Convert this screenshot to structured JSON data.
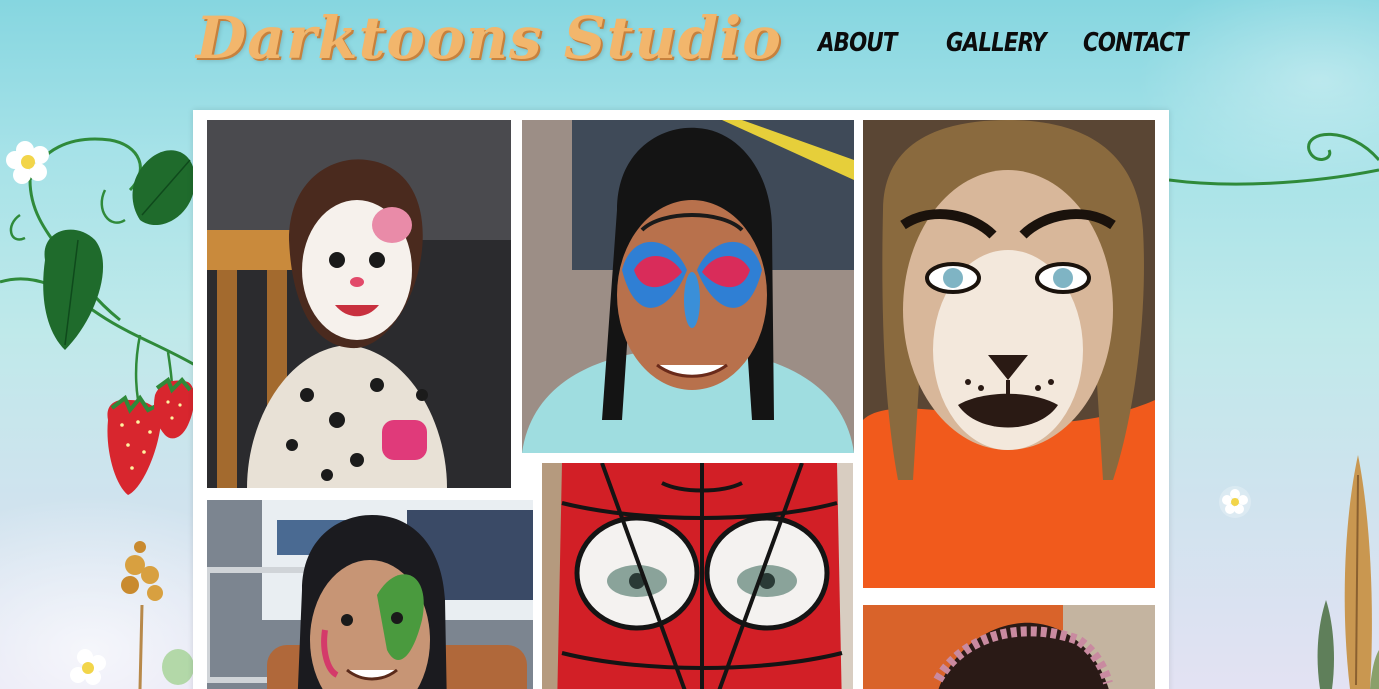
{
  "site": {
    "logo_text": "Darktoons  Studio"
  },
  "nav": {
    "items": [
      {
        "label": "ABOUT"
      },
      {
        "label": "GALLERY"
      },
      {
        "label": "CONTACT"
      }
    ]
  },
  "gallery": {
    "photos": [
      {
        "subject": "kitty face paint"
      },
      {
        "subject": "butterfly face paint"
      },
      {
        "subject": "lion face paint"
      },
      {
        "subject": "dragon face paint"
      },
      {
        "subject": "spider-man face paint"
      },
      {
        "subject": "girl with headband"
      }
    ]
  },
  "colors": {
    "background_top": "#86d6e0",
    "background_bottom": "#e3e2f3",
    "logo": "#f2b66c",
    "nav_text": "#0c0c0c",
    "panel": "#ffffff",
    "vine": "#2f8a3a",
    "strawberry": "#d8262e"
  }
}
